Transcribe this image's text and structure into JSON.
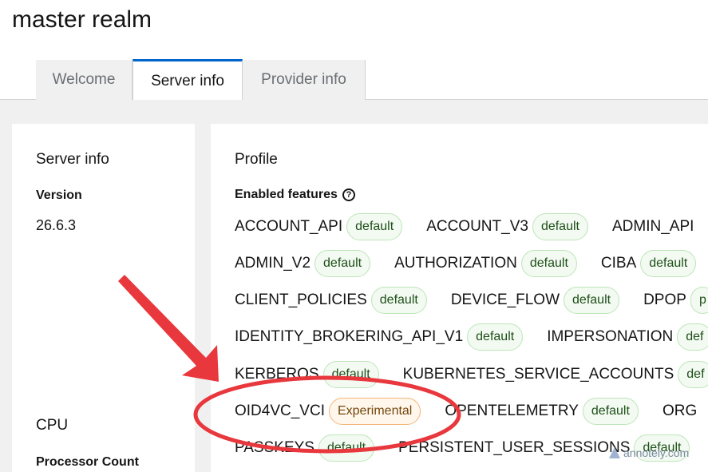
{
  "realm": {
    "title": "master realm"
  },
  "tabs": [
    {
      "label": "Welcome"
    },
    {
      "label": "Server info"
    },
    {
      "label": "Provider info"
    }
  ],
  "server_info": {
    "title": "Server info",
    "version_label": "Version",
    "version_value": "26.6.3",
    "cpu_title": "CPU",
    "processor_count_label": "Processor Count"
  },
  "profile": {
    "title": "Profile",
    "enabled_features_label": "Enabled features",
    "rows": [
      [
        {
          "name": "ACCOUNT_API",
          "badge": "default"
        },
        {
          "name": "ACCOUNT_V3",
          "badge": "default"
        },
        {
          "name": "ADMIN_API",
          "badge": ""
        }
      ],
      [
        {
          "name": "ADMIN_V2",
          "badge": "default"
        },
        {
          "name": "AUTHORIZATION",
          "badge": "default"
        },
        {
          "name": "CIBA",
          "badge": "default"
        }
      ],
      [
        {
          "name": "CLIENT_POLICIES",
          "badge": "default"
        },
        {
          "name": "DEVICE_FLOW",
          "badge": "default"
        },
        {
          "name": "DPOP",
          "badge": "p"
        }
      ],
      [
        {
          "name": "IDENTITY_BROKERING_API_V1",
          "badge": "default"
        },
        {
          "name": "IMPERSONATION",
          "badge": "def"
        }
      ],
      [
        {
          "name": "KERBEROS",
          "badge": "default"
        },
        {
          "name": "KUBERNETES_SERVICE_ACCOUNTS",
          "badge": "def"
        }
      ],
      [
        {
          "name": "OID4VC_VCI",
          "badge": "Experimental"
        },
        {
          "name": "OPENTELEMETRY",
          "badge": "default"
        },
        {
          "name": "ORG",
          "badge": ""
        }
      ],
      [
        {
          "name": "PASSKEYS",
          "badge": "default"
        },
        {
          "name": "PERSISTENT_USER_SESSIONS",
          "badge": "default"
        }
      ]
    ]
  },
  "watermark": {
    "text": "annotely.com"
  },
  "colors": {
    "accent": "#0066cc",
    "annotation": "#e8383d",
    "default_badge": "#f3faf2",
    "experimental_badge": "#fff6ec"
  }
}
